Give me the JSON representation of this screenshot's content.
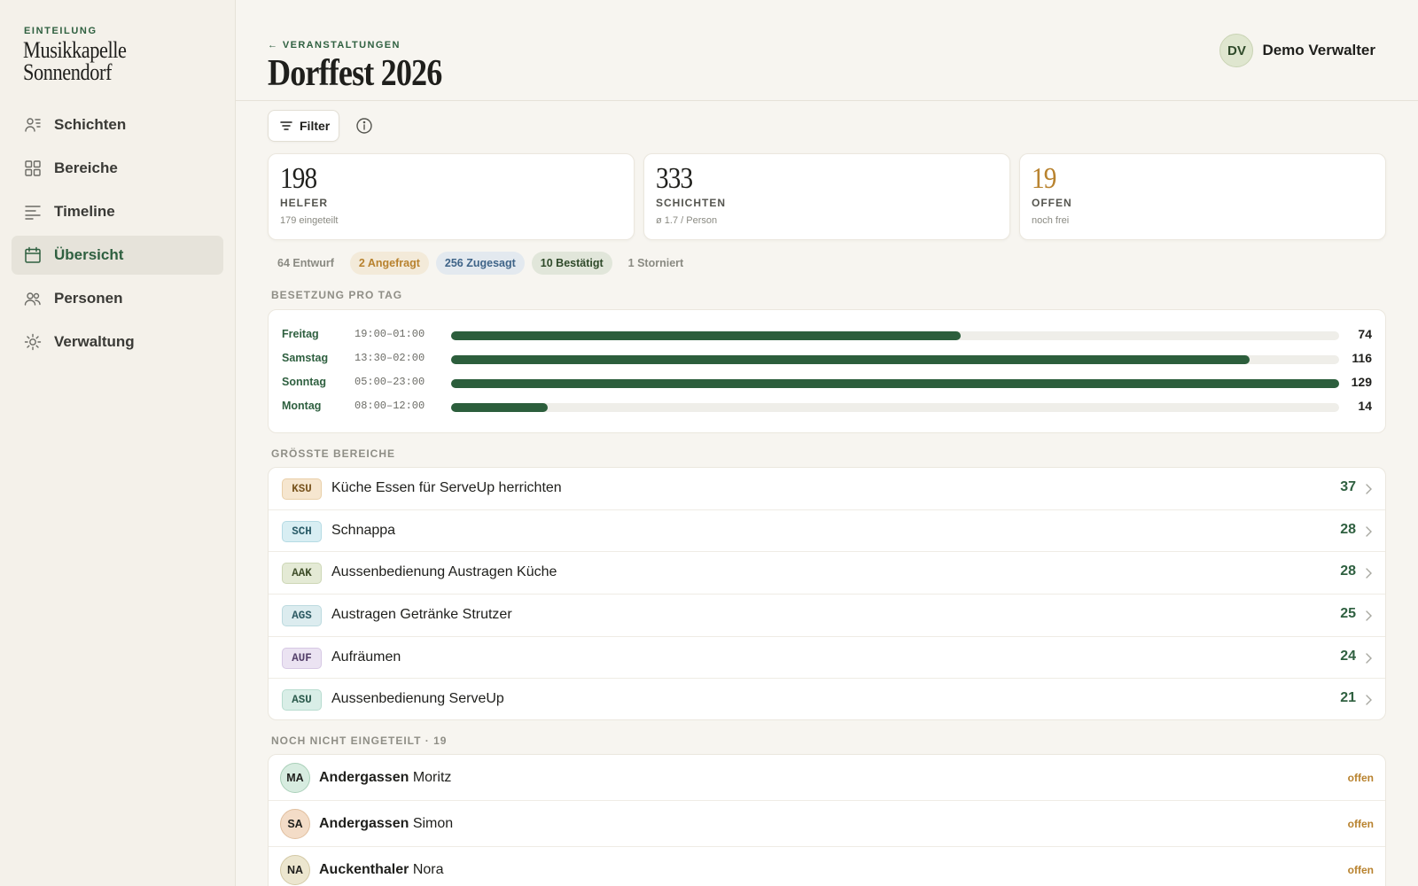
{
  "sidebar": {
    "kicker": "EINTEILUNG",
    "org_line1": "Musikkapelle",
    "org_line2": "Sonnendorf",
    "items": [
      {
        "label": "Schichten",
        "icon": "person-list-icon"
      },
      {
        "label": "Bereiche",
        "icon": "grid-icon"
      },
      {
        "label": "Timeline",
        "icon": "lines-icon"
      },
      {
        "label": "Übersicht",
        "icon": "calendar-icon",
        "active": true
      },
      {
        "label": "Personen",
        "icon": "people-icon"
      },
      {
        "label": "Verwaltung",
        "icon": "gear-icon"
      }
    ]
  },
  "header": {
    "back_label": "← VERANSTALTUNGEN",
    "title": "Dorffest 2026",
    "user_initials": "DV",
    "user_name": "Demo Verwalter"
  },
  "toolbar": {
    "filter_label": "Filter"
  },
  "stats": [
    {
      "value": "198",
      "label": "HELFER",
      "sub": "179 eingeteilt"
    },
    {
      "value": "333",
      "label": "SCHICHTEN",
      "sub": "ø 1.7 / Person"
    },
    {
      "value": "19",
      "label": "OFFEN",
      "sub": "noch frei"
    }
  ],
  "status_pills": [
    {
      "label": "64 Entwurf"
    },
    {
      "label": "2 Angefragt"
    },
    {
      "label": "256 Zugesagt"
    },
    {
      "label": "10 Bestätigt"
    },
    {
      "label": "1 Storniert"
    }
  ],
  "sections": {
    "per_day": "BESETZUNG PRO TAG",
    "areas": "GRÖSSTE BEREICHE",
    "unassigned": "NOCH NICHT EINGETEILT · 19"
  },
  "days": [
    {
      "name": "Freitag",
      "time": "19:00–01:00",
      "count": "74",
      "fill": 0.5736
    },
    {
      "name": "Samstag",
      "time": "13:30–02:00",
      "count": "116",
      "fill": 0.8992
    },
    {
      "name": "Sonntag",
      "time": "05:00–23:00",
      "count": "129",
      "fill": 1.0
    },
    {
      "name": "Montag",
      "time": "08:00–12:00",
      "count": "14",
      "fill": 0.1085
    }
  ],
  "areas": [
    {
      "code": "KSU",
      "name": "Küche Essen für ServeUp herrichten",
      "count": "37",
      "bg": "#f6e6cf",
      "fg": "#7a5520",
      "border": "#e9cfa8"
    },
    {
      "code": "SCH",
      "name": "Schnappa",
      "count": "28",
      "bg": "#d8eef3",
      "fg": "#2a5c68",
      "border": "#b5dbe4"
    },
    {
      "code": "AAK",
      "name": "Aussenbedienung Austragen Küche",
      "count": "28",
      "bg": "#e4ead5",
      "fg": "#3f4e2a",
      "border": "#cdd7b6"
    },
    {
      "code": "AGS",
      "name": "Austragen Getränke Strutzer",
      "count": "25",
      "bg": "#dcecef",
      "fg": "#2d5a63",
      "border": "#bcdadf"
    },
    {
      "code": "AUF",
      "name": "Aufräumen",
      "count": "24",
      "bg": "#ebe3f2",
      "fg": "#54406a",
      "border": "#d6c8e4"
    },
    {
      "code": "ASU",
      "name": "Aussenbedienung ServeUp",
      "count": "21",
      "bg": "#d9eee7",
      "fg": "#2b5a4c",
      "border": "#b7dccf"
    }
  ],
  "persons": [
    {
      "initials": "MA",
      "last": "Andergassen",
      "first": "Moritz",
      "status": "offen",
      "avatar_bg": "#d7ece0",
      "avatar_border": "#a9d0b8"
    },
    {
      "initials": "SA",
      "last": "Andergassen",
      "first": "Simon",
      "status": "offen",
      "avatar_bg": "#f3dcc7",
      "avatar_border": "#e0bf9f"
    },
    {
      "initials": "NA",
      "last": "Auckenthaler",
      "first": "Nora",
      "status": "offen",
      "avatar_bg": "#ece6cf",
      "avatar_border": "#d3c9a6"
    }
  ],
  "colors": {
    "accent_green": "#2f6040",
    "bar_green": "#2c5e3c",
    "warn_amber": "#b8822e"
  }
}
